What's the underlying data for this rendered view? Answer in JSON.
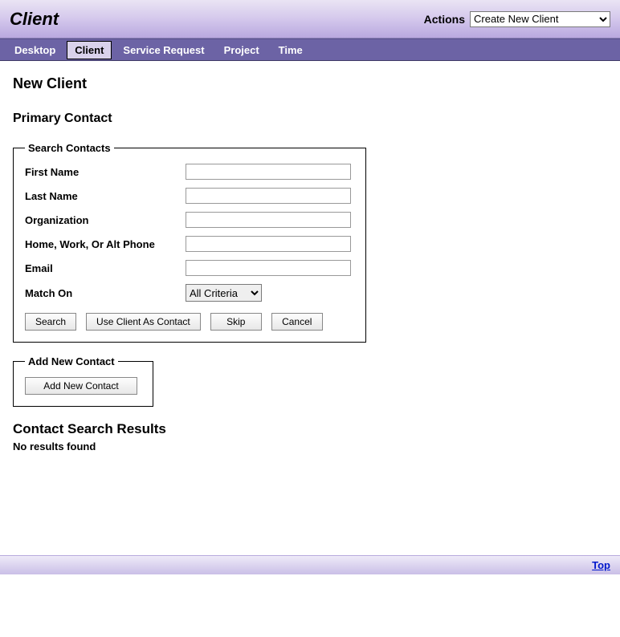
{
  "header": {
    "title": "Client",
    "actions_label": "Actions",
    "actions_selected": "Create New Client"
  },
  "nav": {
    "items": [
      {
        "label": "Desktop",
        "active": false
      },
      {
        "label": "Client",
        "active": true
      },
      {
        "label": "Service Request",
        "active": false
      },
      {
        "label": "Project",
        "active": false
      },
      {
        "label": "Time",
        "active": false
      }
    ]
  },
  "page": {
    "title": "New Client",
    "primary_contact_heading": "Primary Contact"
  },
  "search_contacts": {
    "legend": "Search Contacts",
    "fields": {
      "first_name": {
        "label": "First Name",
        "value": ""
      },
      "last_name": {
        "label": "Last Name",
        "value": ""
      },
      "organization": {
        "label": "Organization",
        "value": ""
      },
      "phone": {
        "label": "Home, Work, Or Alt Phone",
        "value": ""
      },
      "email": {
        "label": "Email",
        "value": ""
      },
      "match_on": {
        "label": "Match On",
        "selected": "All Criteria"
      }
    },
    "buttons": {
      "search": "Search",
      "use_client": "Use Client As Contact",
      "skip": "Skip",
      "cancel": "Cancel"
    }
  },
  "add_new_contact": {
    "legend": "Add New Contact",
    "button": "Add New Contact"
  },
  "results": {
    "heading": "Contact Search Results",
    "no_results": "No results found"
  },
  "footer": {
    "top_link": "Top"
  }
}
